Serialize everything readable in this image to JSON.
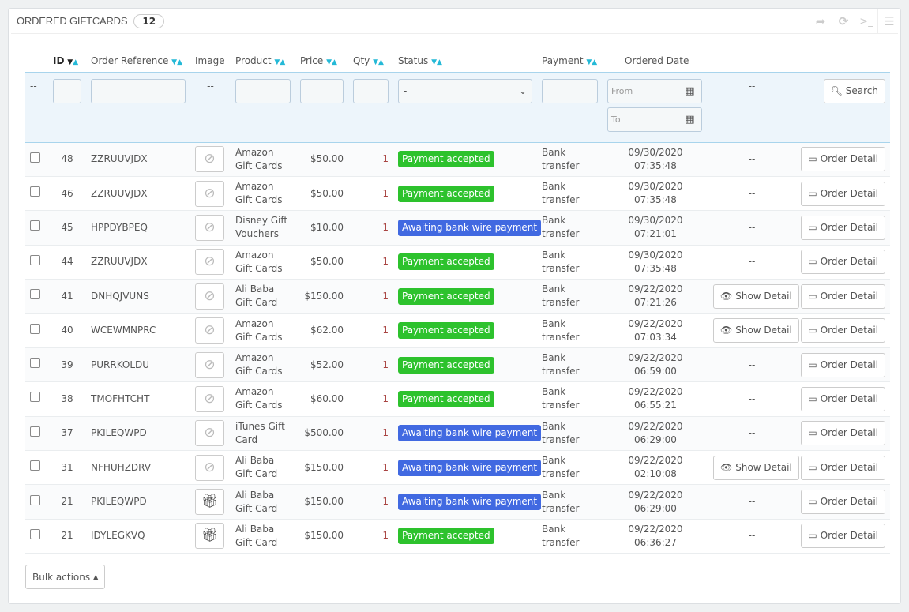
{
  "panel": {
    "title": "Ordered Giftcards",
    "count": "12",
    "tools": [
      "export-icon",
      "refresh-icon",
      "sql-query-icon",
      "database-icon"
    ]
  },
  "columns": {
    "id": "ID",
    "ref": "Order Reference",
    "image": "Image",
    "product": "Product",
    "price": "Price",
    "qty": "Qty",
    "status": "Status",
    "payment": "Payment",
    "date": "Ordered Date"
  },
  "filters": {
    "cb": "--",
    "image": "--",
    "status": "-",
    "from": "From",
    "to": "To",
    "extra": "--",
    "search": "Search"
  },
  "colors": {
    "accepted": "#2dc22d",
    "awaiting": "#4169e1",
    "accent": "#25b9d7"
  },
  "rows": [
    {
      "id": "48",
      "ref": "ZZRUUVJDX",
      "product": "Amazon Gift Cards",
      "price": "$50.00",
      "qty": "1",
      "status": "Payment accepted",
      "type": "accepted",
      "payment": "Bank transfer",
      "date": "09/30/2020",
      "time": "07:35:48",
      "show": "--",
      "img": "no-image"
    },
    {
      "id": "46",
      "ref": "ZZRUUVJDX",
      "product": "Amazon Gift Cards",
      "price": "$50.00",
      "qty": "1",
      "status": "Payment accepted",
      "type": "accepted",
      "payment": "Bank transfer",
      "date": "09/30/2020",
      "time": "07:35:48",
      "show": "--",
      "img": "no-image"
    },
    {
      "id": "45",
      "ref": "HPPDYBPEQ",
      "product": "Disney Gift Vouchers",
      "price": "$10.00",
      "qty": "1",
      "status": "Awaiting bank wire payment",
      "type": "awaiting",
      "payment": "Bank transfer",
      "date": "09/30/2020",
      "time": "07:21:01",
      "show": "--",
      "img": "no-image"
    },
    {
      "id": "44",
      "ref": "ZZRUUVJDX",
      "product": "Amazon Gift Cards",
      "price": "$50.00",
      "qty": "1",
      "status": "Payment accepted",
      "type": "accepted",
      "payment": "Bank transfer",
      "date": "09/30/2020",
      "time": "07:35:48",
      "show": "--",
      "img": "no-image"
    },
    {
      "id": "41",
      "ref": "DNHQJVUNS",
      "product": "Ali Baba Gift Card",
      "price": "$150.00",
      "qty": "1",
      "status": "Payment accepted",
      "type": "accepted",
      "payment": "Bank transfer",
      "date": "09/22/2020",
      "time": "07:21:26",
      "show": "Show Detail",
      "img": "no-image"
    },
    {
      "id": "40",
      "ref": "WCEWMNPRC",
      "product": "Amazon Gift Cards",
      "price": "$62.00",
      "qty": "1",
      "status": "Payment accepted",
      "type": "accepted",
      "payment": "Bank transfer",
      "date": "09/22/2020",
      "time": "07:03:34",
      "show": "Show Detail",
      "img": "no-image"
    },
    {
      "id": "39",
      "ref": "PURRKOLDU",
      "product": "Amazon Gift Cards",
      "price": "$52.00",
      "qty": "1",
      "status": "Payment accepted",
      "type": "accepted",
      "payment": "Bank transfer",
      "date": "09/22/2020",
      "time": "06:59:00",
      "show": "--",
      "img": "no-image"
    },
    {
      "id": "38",
      "ref": "TMOFHTCHT",
      "product": "Amazon Gift Cards",
      "price": "$60.00",
      "qty": "1",
      "status": "Payment accepted",
      "type": "accepted",
      "payment": "Bank transfer",
      "date": "09/22/2020",
      "time": "06:55:21",
      "show": "--",
      "img": "no-image"
    },
    {
      "id": "37",
      "ref": "PKILEQWPD",
      "product": "iTunes Gift Card",
      "price": "$500.00",
      "qty": "1",
      "status": "Awaiting bank wire payment",
      "type": "awaiting",
      "payment": "Bank transfer",
      "date": "09/22/2020",
      "time": "06:29:00",
      "show": "--",
      "img": "no-image"
    },
    {
      "id": "31",
      "ref": "NFHUHZDRV",
      "product": "Ali Baba Gift Card",
      "price": "$150.00",
      "qty": "1",
      "status": "Awaiting bank wire payment",
      "type": "awaiting",
      "payment": "Bank transfer",
      "date": "09/22/2020",
      "time": "02:10:08",
      "show": "Show Detail",
      "img": "no-image"
    },
    {
      "id": "21",
      "ref": "PKILEQWPD",
      "product": "Ali Baba Gift Card",
      "price": "$150.00",
      "qty": "1",
      "status": "Awaiting bank wire payment",
      "type": "awaiting",
      "payment": "Bank transfer",
      "date": "09/22/2020",
      "time": "06:29:00",
      "show": "--",
      "img": "gift-card"
    },
    {
      "id": "21",
      "ref": "IDYLEGKVQ",
      "product": "Ali Baba Gift Card",
      "price": "$150.00",
      "qty": "1",
      "status": "Payment accepted",
      "type": "accepted",
      "payment": "Bank transfer",
      "date": "09/22/2020",
      "time": "06:36:27",
      "show": "--",
      "img": "gift-card"
    }
  ],
  "order_detail": "Order Detail",
  "bulk": "Bulk actions"
}
